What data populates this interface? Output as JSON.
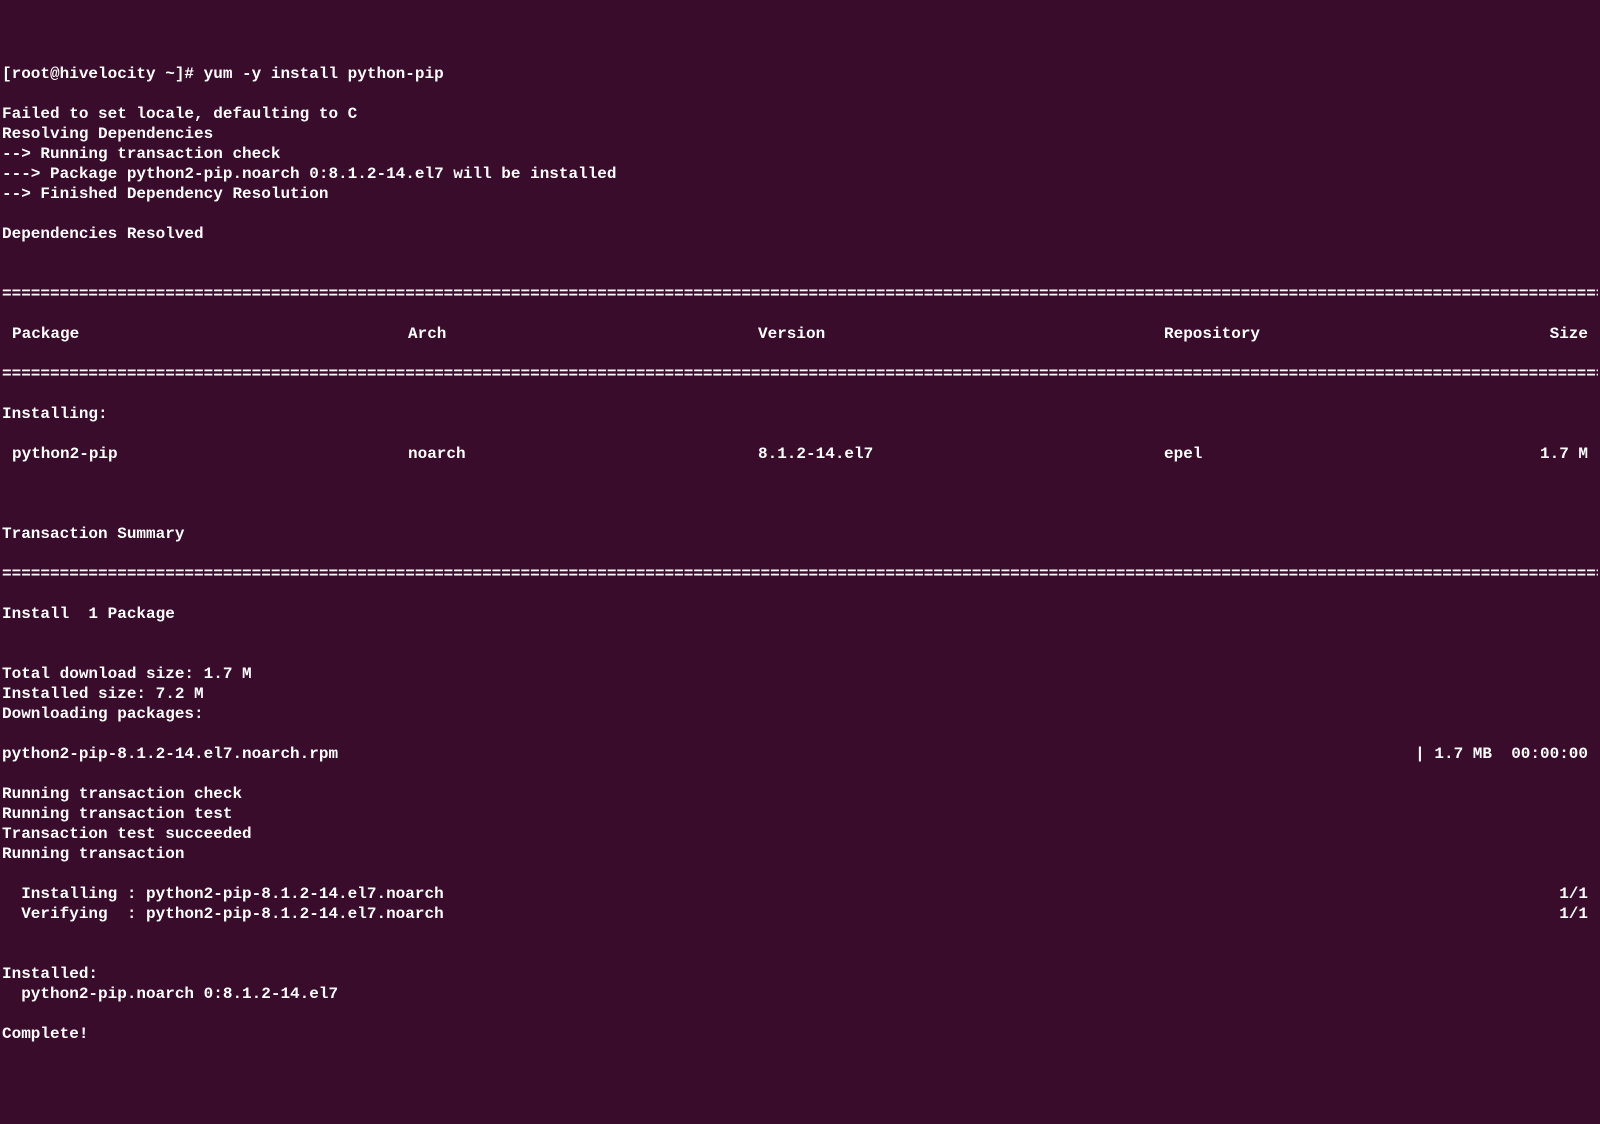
{
  "prompt": "[root@hivelocity ~]# yum -y install python-pip",
  "pre_lines": [
    "Failed to set locale, defaulting to C",
    "Resolving Dependencies",
    "--> Running transaction check",
    "---> Package python2-pip.noarch 0:8.1.2-14.el7 will be installed",
    "--> Finished Dependency Resolution",
    "",
    "Dependencies Resolved",
    ""
  ],
  "rule": "================================================================================================================================================================================================================",
  "table_headers": {
    "package": "Package",
    "arch": "Arch",
    "version": "Version",
    "repository": "Repository",
    "size": "Size"
  },
  "installing_label": "Installing:",
  "table_row": {
    "package": "python2-pip",
    "arch": "noarch",
    "version": "8.1.2-14.el7",
    "repository": "epel",
    "size": "1.7 M"
  },
  "txn_summary_label": "Transaction Summary",
  "install_count": "Install  1 Package",
  "post_lines_1": [
    "",
    "Total download size: 1.7 M",
    "Installed size: 7.2 M",
    "Downloading packages:"
  ],
  "download_row": {
    "left": "python2-pip-8.1.2-14.el7.noarch.rpm",
    "right": "| 1.7 MB  00:00:00"
  },
  "post_lines_2": [
    "Running transaction check",
    "Running transaction test",
    "Transaction test succeeded",
    "Running transaction"
  ],
  "progress_rows": [
    {
      "left": "  Installing : python2-pip-8.1.2-14.el7.noarch",
      "right": "1/1"
    },
    {
      "left": "  Verifying  : python2-pip-8.1.2-14.el7.noarch",
      "right": "1/1"
    }
  ],
  "post_lines_3": [
    "",
    "Installed:",
    "  python2-pip.noarch 0:8.1.2-14.el7",
    "",
    "Complete!"
  ]
}
